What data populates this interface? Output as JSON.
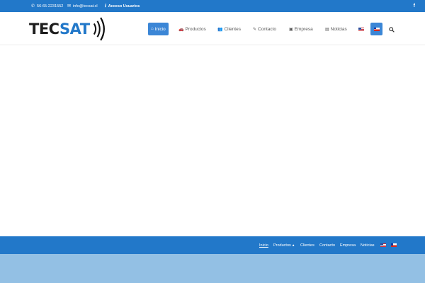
{
  "topbar": {
    "phone": "56-65-2231552",
    "email": "info@tecsat.cl",
    "access": "Acceso Usuarios",
    "facebook": "f"
  },
  "logo": {
    "part1": "TEC",
    "part2": "SAT"
  },
  "nav": {
    "items": [
      {
        "label": "Inicio",
        "icon": "⌂"
      },
      {
        "label": "Productos",
        "icon": "🚗"
      },
      {
        "label": "Clientes",
        "icon": "👥"
      },
      {
        "label": "Contacto",
        "icon": "✎"
      },
      {
        "label": "Empresa",
        "icon": "▣"
      },
      {
        "label": "Noticias",
        "icon": "▤"
      }
    ]
  },
  "footer": {
    "items": [
      {
        "label": "Inicio"
      },
      {
        "label": "Productos",
        "caret": "▴"
      },
      {
        "label": "Clientes"
      },
      {
        "label": "Contacto"
      },
      {
        "label": "Empresa"
      },
      {
        "label": "Noticias"
      }
    ]
  },
  "colors": {
    "primary": "#2278c9",
    "active": "#3b86d6",
    "bottom": "#93c0e4"
  }
}
